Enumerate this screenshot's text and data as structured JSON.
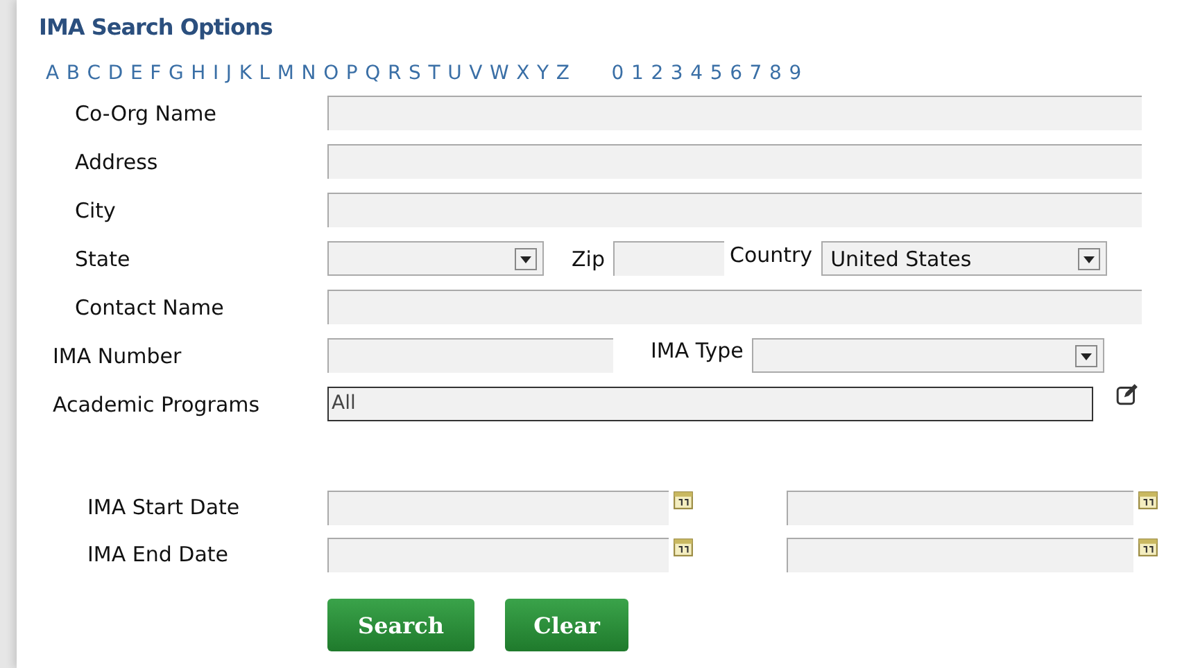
{
  "title": "IMA Search Options",
  "letters": [
    "A",
    "B",
    "C",
    "D",
    "E",
    "F",
    "G",
    "H",
    "I",
    "J",
    "K",
    "L",
    "M",
    "N",
    "O",
    "P",
    "Q",
    "R",
    "S",
    "T",
    "U",
    "V",
    "W",
    "X",
    "Y",
    "Z"
  ],
  "digits": [
    "0",
    "1",
    "2",
    "3",
    "4",
    "5",
    "6",
    "7",
    "8",
    "9"
  ],
  "co_org_name": {
    "label": "Co-Org Name"
  },
  "address": {
    "label": "Address"
  },
  "city": {
    "label": "City"
  },
  "state": {
    "label": "State"
  },
  "zip": {
    "label": "Zip"
  },
  "country": {
    "label": "Country",
    "value": "United States"
  },
  "contact_name": {
    "label": "Contact Name"
  },
  "ima_number": {
    "label": "IMA Number"
  },
  "ima_type": {
    "label": "IMA Type"
  },
  "academic_programs": {
    "label": "Academic Programs",
    "value": "All"
  },
  "ima_start_date": {
    "label": "IMA Start Date"
  },
  "ima_end_date": {
    "label": "IMA End Date"
  },
  "buttons": [
    "Search",
    "Clear"
  ]
}
